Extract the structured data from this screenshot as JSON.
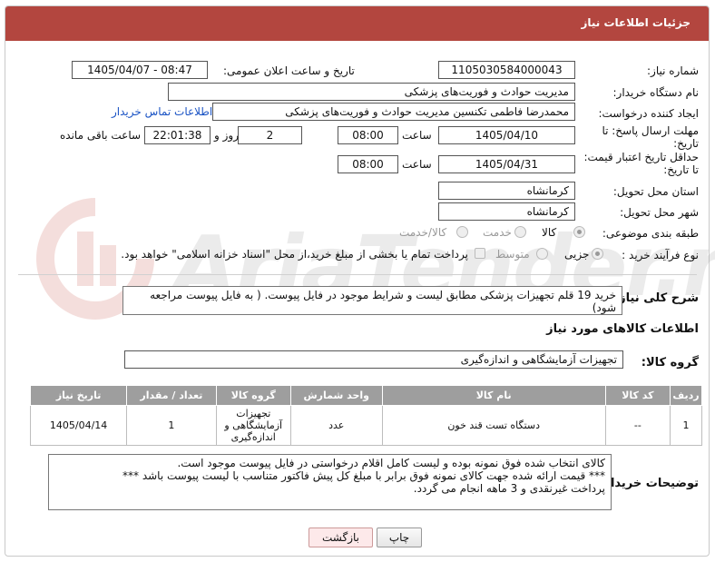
{
  "header": {
    "title": "جزئیات اطلاعات نیاز"
  },
  "fields": {
    "need_number_label": "شماره نیاز:",
    "need_number": "1105030584000043",
    "announce_label": "تاریخ و ساعت اعلان عمومی:",
    "announce_value": "1405/04/07 - 08:47",
    "buyer_org_label": "نام دستگاه خریدار:",
    "buyer_org": "مدیریت حوادث و فوریت‌های پزشکی",
    "creator_label": "ایجاد کننده درخواست:",
    "creator": "محمدرضا فاطمی تکنسین مدیریت حوادث و فوریت‌های پزشکی",
    "contact_link": "اطلاعات تماس خریدار",
    "reply_deadline_label": "مهلت ارسال پاسخ: تا تاریخ:",
    "reply_date": "1405/04/10",
    "time_label": "ساعت",
    "reply_time": "08:00",
    "days_value": "2",
    "days_label": "روز و",
    "remaining_time": "22:01:38",
    "remaining_label": "ساعت باقی مانده",
    "price_validity_label": "حداقل تاریخ اعتبار قیمت: تا تاریخ:",
    "price_date": "1405/04/31",
    "price_time": "08:00",
    "province_label": "استان محل تحویل:",
    "province": "کرمانشاه",
    "city_label": "شهر محل تحویل:",
    "city": "کرمانشاه",
    "category_label": "طبقه بندی موضوعی:",
    "category_options": [
      "کالا",
      "خدمت",
      "کالا/خدمت"
    ],
    "process_label": "نوع فرآیند خرید :",
    "process_options": [
      "جزیی",
      "متوسط"
    ],
    "payment_note": "پرداخت تمام یا بخشی از مبلغ خرید،از محل \"اسناد خزانه اسلامی\" خواهد بود."
  },
  "description": {
    "label": "شرح کلی نیاز:",
    "text": "خرید 19 قلم تجهیزات پزشکی مطابق لیست و شرایط موجود در فایل پیوست. ( به فایل پیوست مراجعه شود)"
  },
  "goods_section": {
    "title": "اطلاعات کالاهای مورد نیاز",
    "group_label": "گروه کالا:",
    "group_value": "تجهیزات آزمایشگاهی و اندازه‌گیری"
  },
  "table": {
    "headers": [
      "ردیف",
      "کد کالا",
      "نام کالا",
      "واحد شمارش",
      "گروه کالا",
      "تعداد / مقدار",
      "تاریخ نیاز"
    ],
    "rows": [
      [
        "1",
        "--",
        "دستگاه تست قند خون",
        "عدد",
        "تجهیزات آزمایشگاهی و اندازه‌گیری",
        "1",
        "1405/04/14"
      ]
    ]
  },
  "buyer_notes": {
    "label": "توضیحات خریدار:",
    "lines": [
      "کالای انتخاب شده فوق نمونه بوده و لیست کامل اقلام درخواستی در فایل پیوست موجود است.",
      "*** قیمت ارائه شده جهت کالای نمونه فوق برابر با مبلغ کل پیش فاکتور متناسب با لیست پیوست باشد ***",
      "پرداخت غیرنقدی و 3 ماهه انجام می گردد."
    ]
  },
  "buttons": {
    "print": "چاپ",
    "back": "بازگشت"
  },
  "watermark": "AriaTender.net",
  "colors": {
    "header": "#b3463f",
    "table_header": "#9e9e9e",
    "link": "#1a53c4"
  }
}
